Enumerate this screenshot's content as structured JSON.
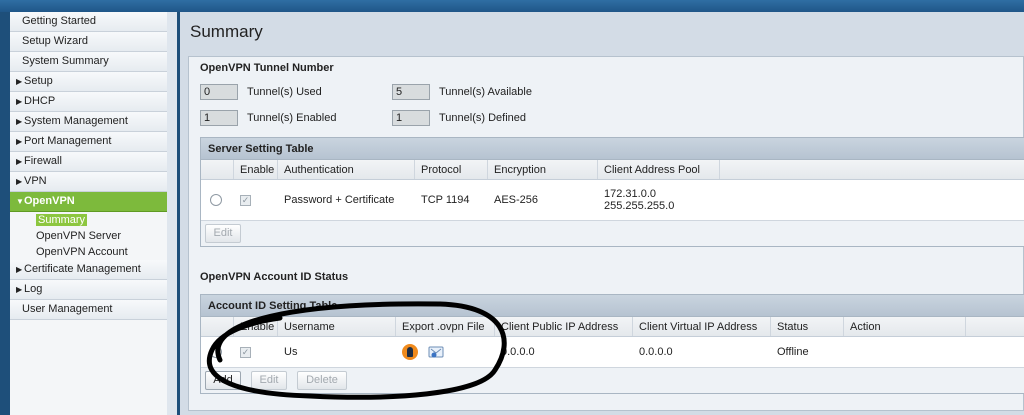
{
  "sidebar": {
    "items": [
      {
        "label": "Getting Started",
        "expandable": false
      },
      {
        "label": "Setup Wizard",
        "expandable": false
      },
      {
        "label": "System Summary",
        "expandable": false
      },
      {
        "label": "Setup",
        "expandable": true
      },
      {
        "label": "DHCP",
        "expandable": true
      },
      {
        "label": "System Management",
        "expandable": true
      },
      {
        "label": "Port Management",
        "expandable": true
      },
      {
        "label": "Firewall",
        "expandable": true
      },
      {
        "label": "VPN",
        "expandable": true
      },
      {
        "label": "OpenVPN",
        "expandable": true,
        "active": true
      },
      {
        "label": "Certificate Management",
        "expandable": true
      },
      {
        "label": "Log",
        "expandable": true
      },
      {
        "label": "User Management",
        "expandable": false
      }
    ],
    "openvpn_subitems": [
      "Summary",
      "OpenVPN Server",
      "OpenVPN Account"
    ],
    "selected_subitem": "Summary"
  },
  "main": {
    "title": "Summary",
    "tunnel_section_title": "OpenVPN Tunnel Number",
    "tunnels": {
      "used_value": "0",
      "used_label": "Tunnel(s) Used",
      "available_value": "5",
      "available_label": "Tunnel(s) Available",
      "enabled_value": "1",
      "enabled_label": "Tunnel(s) Enabled",
      "defined_value": "1",
      "defined_label": "Tunnel(s) Defined"
    },
    "server_table": {
      "title": "Server Setting Table",
      "headers": [
        "Enable",
        "Authentication",
        "Protocol",
        "Encryption",
        "Client Address Pool"
      ],
      "row": {
        "authentication": "Password + Certificate",
        "protocol": "TCP 1194",
        "encryption": "AES-256",
        "pool_address": "172.31.0.0",
        "pool_mask": "255.255.255.0"
      },
      "edit_label": "Edit"
    },
    "account_section_title": "OpenVPN Account ID Status",
    "account_table": {
      "title": "Account ID Setting Table",
      "headers": [
        "Enable",
        "Username",
        "Export .ovpn File",
        "Client Public IP Address",
        "Client Virtual IP Address",
        "Status",
        "Action"
      ],
      "row": {
        "username": "Us",
        "public_ip": "0.0.0.0",
        "virtual_ip": "0.0.0.0",
        "status": "Offline"
      },
      "add_label": "Add",
      "edit_label": "Edit",
      "delete_label": "Delete"
    }
  },
  "colors": {
    "accent_green": "#7dba3c",
    "openvpn_orange": "#f08a1c"
  }
}
